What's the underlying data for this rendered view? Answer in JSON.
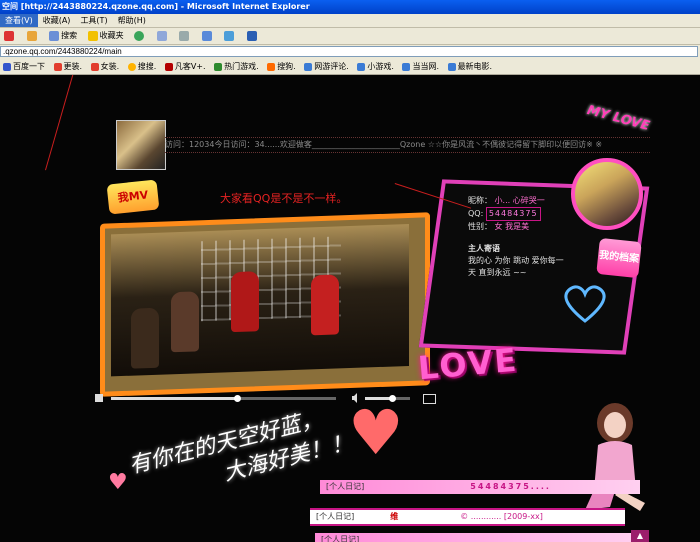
{
  "window": {
    "title": "空间 [http://2443880224.qzone.qq.com] - Microsoft Internet Explorer"
  },
  "menu": {
    "items": [
      "查看(V)",
      "收藏(A)",
      "工具(T)",
      "帮助(H)"
    ]
  },
  "toolbar": {
    "search_label": "搜索",
    "favorites_label": "收藏夹"
  },
  "address": {
    "value": ".qzone.qq.com/2443880224/main"
  },
  "links": {
    "items": [
      {
        "label": "百度一下",
        "icon": "paw-icon",
        "color": "#3355cc"
      },
      {
        "label": "更装.",
        "icon": "qq-icon",
        "color": "#e23d2d"
      },
      {
        "label": "女装.",
        "icon": "qq-icon",
        "color": "#e23d2d"
      },
      {
        "label": "搜搜.",
        "icon": "soso-icon",
        "color": "#ffb300"
      },
      {
        "label": "凡客V+.",
        "icon": "vancl-icon",
        "color": "#b30000"
      },
      {
        "label": "热门游戏.",
        "icon": "game-icon",
        "color": "#2d8a2d"
      },
      {
        "label": "搜狗.",
        "icon": "sogou-icon",
        "color": "#ff6a00"
      },
      {
        "label": "网游评论.",
        "icon": "page-icon",
        "color": "#3a7bd5"
      },
      {
        "label": "小游戏.",
        "icon": "page-icon",
        "color": "#3a7bd5"
      },
      {
        "label": "当当网.",
        "icon": "dangdang-icon",
        "color": "#3a7bd5"
      },
      {
        "label": "最新电影.",
        "icon": "page-icon",
        "color": "#3a7bd5"
      }
    ]
  },
  "profile": {
    "marquee": "访问：12034今日访问：34......欢迎做客______________________Qzone ☆☆你是风流丶不偶彼记得留下脚印以便回访※ ※",
    "my_love": "MY LOVE",
    "mv_badge": "我MV",
    "caption": "大家看QQ是不是不一样。",
    "info_name_label": "昵称：",
    "info_name_value": "小... 心碎哭一",
    "info_qq_label": "QQ:",
    "info_qq_value": "54484375",
    "info_extra": "性别：",
    "info_extra_value": "女 我是美",
    "owner_label": "主人寄语",
    "owner_text": "我的心 为你 跳动 爱你每一天 直到永远 ~~",
    "dang_badge": "我的档案",
    "love_word": "LOVE",
    "handwriting_line1": "有你在的天空好蓝，",
    "handwriting_line2": "大海好美！！",
    "volume_value": 0.6,
    "progress_value": 0.56
  },
  "blogs": {
    "items": [
      {
        "tag": "[个人日记]",
        "title": "54484375....",
        "extra": ""
      },
      {
        "tag": "[个人日记]",
        "title": "维",
        "extra": "©  ............  [2009-xx]"
      },
      {
        "tag": "[个人日记]",
        "title": "",
        "extra": ""
      }
    ]
  },
  "colors": {
    "accent": "#ff40b0",
    "frame_orange": "#ff8c1a",
    "caption_red": "#e52222"
  }
}
